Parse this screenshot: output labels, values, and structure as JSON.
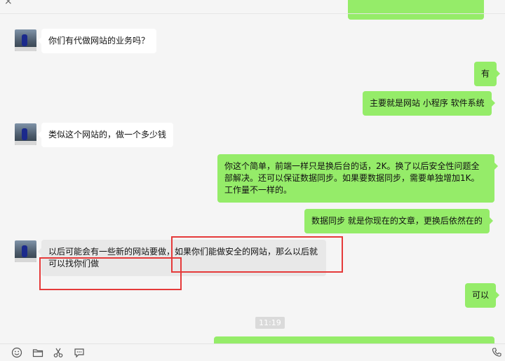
{
  "chat": {
    "messages": [
      {
        "from": "them",
        "text": "你们有代做网站的业务吗？"
      },
      {
        "from": "me",
        "text": "有"
      },
      {
        "from": "me",
        "text": "主要就是网站 小程序 软件系统"
      },
      {
        "from": "them",
        "text": "类似这个网站的，做一个多少钱"
      },
      {
        "from": "me",
        "text": "你这个简单，前端一样只是换后台的话，2K。换了以后安全性问题全部解决。还可以保证数据同步。如果要数据同步，需要单独增加1K。工作量不一样的。"
      },
      {
        "from": "me",
        "text": "数据同步 就是你现在的文章，更换后依然在的"
      },
      {
        "from": "them",
        "text": "以后可能会有一些新的网站要做，如果你们能做安全的网站，那么以后就可以找你们做"
      },
      {
        "from": "me",
        "text": "可以"
      }
    ],
    "timestamp": "11:19"
  },
  "toolbar": {
    "icons": [
      "emoji-icon",
      "folder-icon",
      "scissors-icon",
      "chat-history-icon",
      "phone-icon"
    ]
  },
  "colors": {
    "outgoing_bubble": "#95ec69",
    "incoming_bubble": "#ffffff",
    "background": "#f5f5f5",
    "annotation": "#e53a3a"
  }
}
